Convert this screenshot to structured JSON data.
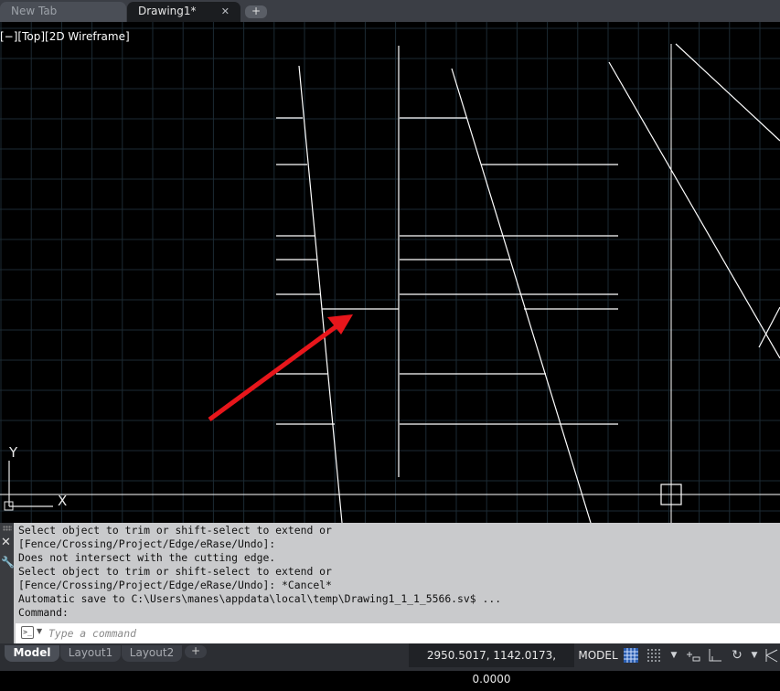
{
  "tabs": {
    "new_tab": "New Tab",
    "drawing": "Drawing1*",
    "close_glyph": "✕",
    "add_glyph": "+"
  },
  "viewport": {
    "view_label": "[−][Top][2D Wireframe]",
    "ucs_y": "Y",
    "ucs_x": "X",
    "background_color": "#000000",
    "grid_color": "#1c2a33",
    "geometry_color": "#ffffff",
    "arrow_color": "#e8161b"
  },
  "command": {
    "history": [
      "Select object to trim or shift-select to extend or",
      "[Fence/Crossing/Project/Edge/eRase/Undo]:",
      "Does not intersect with the cutting edge.",
      "Select object to trim or shift-select to extend or",
      "[Fence/Crossing/Project/Edge/eRase/Undo]: *Cancel*",
      "Automatic save to C:\\Users\\manes\\appdata\\local\\temp\\Drawing1_1_1_5566.sv$ ...",
      "Command:"
    ],
    "input_placeholder": "Type a command",
    "close_glyph": "✕",
    "wrench_icon": "wrench-icon"
  },
  "status": {
    "layout_tabs": [
      "Model",
      "Layout1",
      "Layout2"
    ],
    "layout_add_glyph": "+",
    "coordinates": "2950.5017, 1142.0173, 0.0000",
    "model_label": "MODEL",
    "icons": [
      "grid-icon",
      "snap-icon",
      "dropdown-icon",
      "infer-constraints-icon",
      "dynamic-input-icon",
      "ortho-icon",
      "polar-tracking-icon",
      "dropdown-icon",
      "isometric-drafting-icon"
    ]
  }
}
